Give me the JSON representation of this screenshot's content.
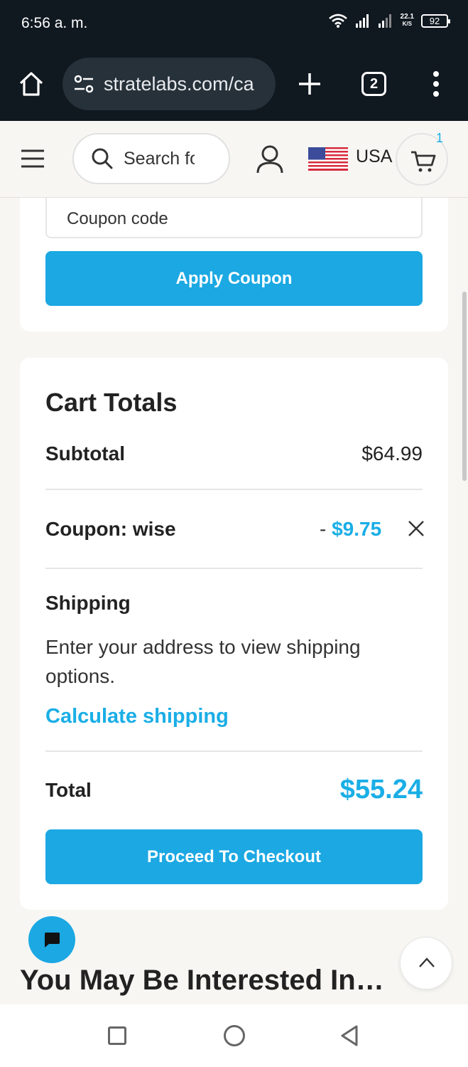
{
  "status_bar": {
    "time": "6:56 a. m.",
    "net_speed_value": "22.1",
    "net_speed_unit": "K/S",
    "battery": "92",
    "icons": [
      "wifi-icon",
      "signal-icon",
      "signal-icon",
      "battery-icon"
    ]
  },
  "browser": {
    "url": "stratelabs.com/ca",
    "tab_count": "2"
  },
  "header": {
    "search_placeholder": "Search for products",
    "country": "USA",
    "cart_count": "1"
  },
  "coupon": {
    "placeholder": "Coupon code",
    "apply_label": "Apply Coupon"
  },
  "totals": {
    "title": "Cart Totals",
    "subtotal_label": "Subtotal",
    "subtotal_value": "$64.99",
    "coupon_label": "Coupon: wise",
    "coupon_dash": "-",
    "coupon_value": "$9.75",
    "shipping_label": "Shipping",
    "shipping_text": "Enter your address to view shipping options.",
    "calculate_link": "Calculate shipping",
    "total_label": "Total",
    "total_value": "$55.24",
    "checkout_label": "Proceed To Checkout"
  },
  "section": {
    "interested_heading": "You May Be Interested In…"
  },
  "colors": {
    "accent": "#1ba8e3",
    "chrome_dark": "#101820",
    "page_bg": "#f7f6f3"
  }
}
